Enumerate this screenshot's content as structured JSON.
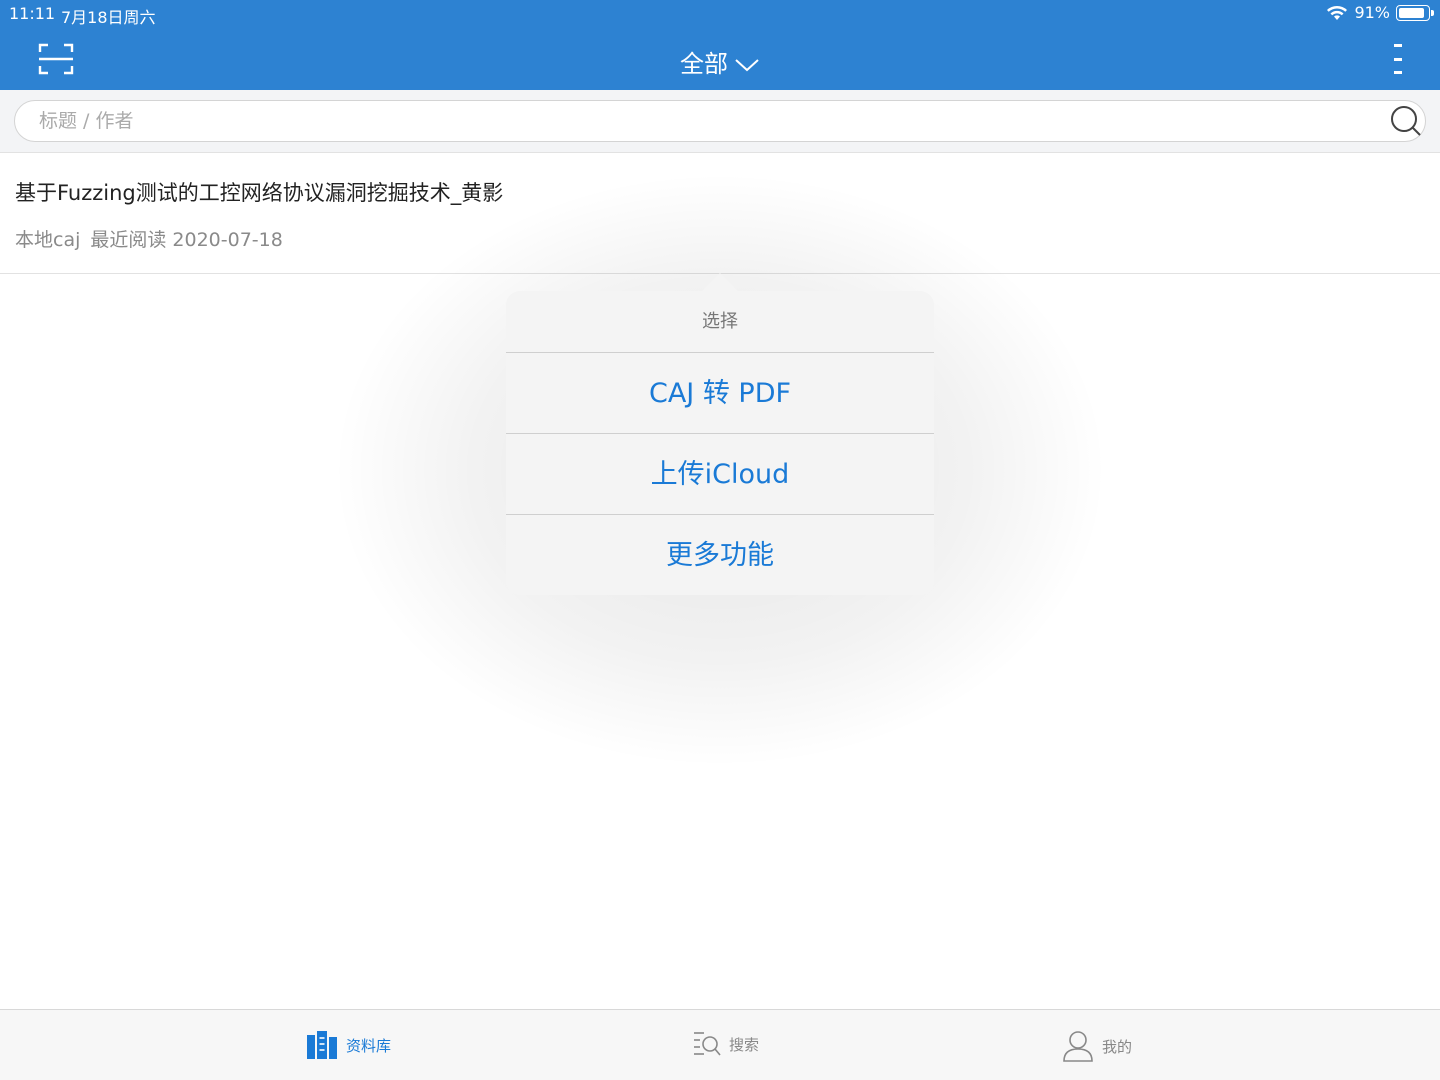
{
  "status_bar": {
    "time": "11:11",
    "date": "7月18日周六",
    "battery": "91%",
    "battery_level": 0.91
  },
  "nav": {
    "title": "全部",
    "icons": {
      "scan": "scan-icon",
      "dropdown": "chevron-down-icon",
      "more": "more-vertical-icon"
    }
  },
  "search": {
    "placeholder": "标题 / 作者",
    "value": "",
    "icon": "search-icon"
  },
  "documents": [
    {
      "title": "基于Fuzzing测试的工控网络协议漏洞挖掘技术_黄影",
      "source": "本地caj",
      "last_read": "最近阅读 2020-07-18"
    }
  ],
  "popover": {
    "header": "选择",
    "actions": [
      "CAJ 转 PDF",
      "上传iCloud",
      "更多功能"
    ]
  },
  "tabbar": {
    "tabs": [
      {
        "label": "资料库",
        "icon": "library-icon",
        "active": true
      },
      {
        "label": "搜索",
        "icon": "search-list-icon",
        "active": false
      },
      {
        "label": "我的",
        "icon": "user-icon",
        "active": false
      }
    ]
  },
  "colors": {
    "nav_bg": "#2d82d2",
    "accent": "#1a7ad6",
    "popover_bg": "#f4f4f4"
  }
}
